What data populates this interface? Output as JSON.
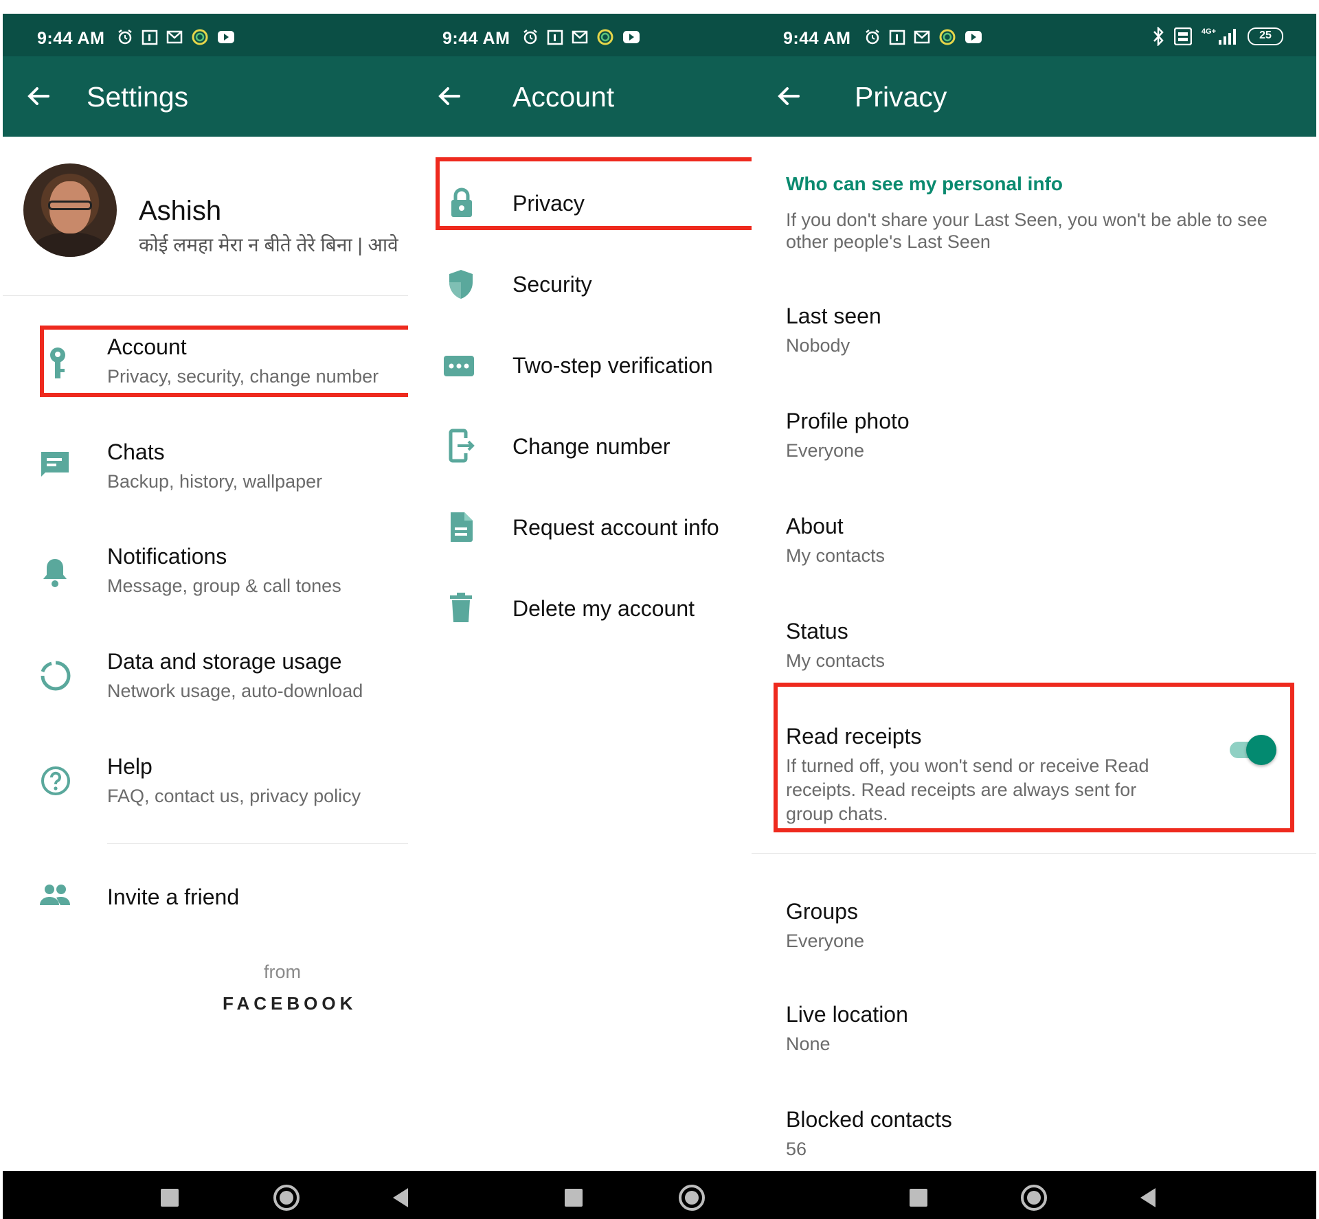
{
  "status": {
    "time": "9:44 AM",
    "battery": "25",
    "network": "4G+"
  },
  "colors": {
    "accent": "#0f5e52",
    "statusbar": "#0b4f45",
    "icon": "#5aa89c",
    "highlight": "#ee2a1e",
    "section": "#0a8a6f"
  },
  "settings": {
    "title": "Settings",
    "profile": {
      "name": "Ashish",
      "about": "कोई लमहा मेरा न बीते तेरे बिना | आवे"
    },
    "items": [
      {
        "label": "Account",
        "sub": "Privacy, security, change number",
        "icon": "key-icon"
      },
      {
        "label": "Chats",
        "sub": "Backup, history, wallpaper",
        "icon": "chat-icon"
      },
      {
        "label": "Notifications",
        "sub": "Message, group & call tones",
        "icon": "bell-icon"
      },
      {
        "label": "Data and storage usage",
        "sub": "Network usage, auto-download",
        "icon": "data-usage-icon"
      },
      {
        "label": "Help",
        "sub": "FAQ, contact us, privacy policy",
        "icon": "help-icon"
      },
      {
        "label": "Invite a friend",
        "icon": "people-icon"
      }
    ],
    "from": "from",
    "brand": "FACEBOOK"
  },
  "account": {
    "title": "Account",
    "items": [
      {
        "label": "Privacy",
        "icon": "lock-icon"
      },
      {
        "label": "Security",
        "icon": "shield-icon"
      },
      {
        "label": "Two-step verification",
        "icon": "dots-icon"
      },
      {
        "label": "Change number",
        "icon": "change-number-icon"
      },
      {
        "label": "Request account info",
        "icon": "document-icon"
      },
      {
        "label": "Delete my account",
        "icon": "trash-icon"
      }
    ]
  },
  "privacy": {
    "title": "Privacy",
    "section_heading": "Who can see my personal info",
    "section_desc_1": "If you don't share your Last Seen, you won't be able to see",
    "section_desc_2": "other people's Last Seen",
    "items": [
      {
        "label": "Last seen",
        "value": "Nobody"
      },
      {
        "label": "Profile photo",
        "value": "Everyone"
      },
      {
        "label": "About",
        "value": "My contacts"
      },
      {
        "label": "Status",
        "value": "My contacts"
      }
    ],
    "read_receipts": {
      "label": "Read receipts",
      "desc_1": "If turned off, you won't send or receive Read",
      "desc_2": "receipts. Read receipts are always sent for",
      "desc_3": "group chats.",
      "enabled": true
    },
    "items2": [
      {
        "label": "Groups",
        "value": "Everyone"
      },
      {
        "label": "Live location",
        "value": "None"
      },
      {
        "label": "Blocked contacts",
        "value": "56"
      }
    ]
  }
}
